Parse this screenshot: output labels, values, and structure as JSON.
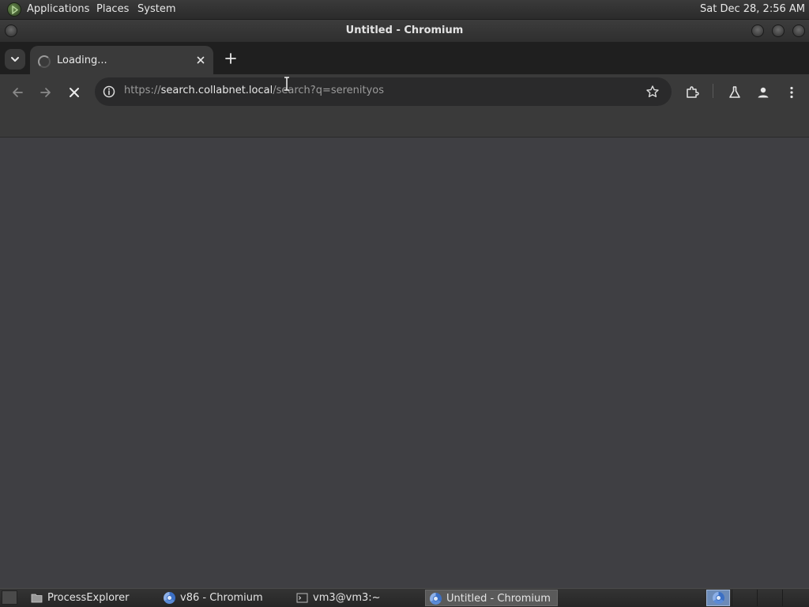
{
  "top_panel": {
    "menus": [
      "Applications",
      "Places",
      "System"
    ],
    "clock": "Sat Dec 28,  2:56 AM"
  },
  "window": {
    "title": "Untitled - Chromium"
  },
  "browser": {
    "active_tab": {
      "title": "Loading...",
      "state": "loading"
    },
    "address": {
      "scheme": "https://",
      "host": "search.collabnet.local",
      "path": "/search?q=serenityos"
    },
    "toolbar_icons": [
      "back-icon",
      "forward-icon",
      "stop-icon",
      "site-info-icon",
      "bookmark-star-icon",
      "extensions-icon",
      "labs-icon",
      "profile-icon",
      "menu-icon"
    ]
  },
  "taskbar": {
    "tasks": [
      {
        "label": "ProcessExplorer",
        "icon": "folder-icon",
        "active": false
      },
      {
        "label": "v86 - Chromium",
        "icon": "chromium-icon",
        "active": false
      },
      {
        "label": "vm3@vm3:~",
        "icon": "terminal-icon",
        "active": false
      },
      {
        "label": "Untitled - Chromium",
        "icon": "chromium-icon",
        "active": true
      }
    ]
  },
  "colors": {
    "page_bg": "#3f3f43",
    "toolbar_bg": "#3a3a3a",
    "tabstrip_bg": "#1f1f1f",
    "omnibox_bg": "#2a2a2b",
    "workspace_active": "#6c8bb8"
  }
}
